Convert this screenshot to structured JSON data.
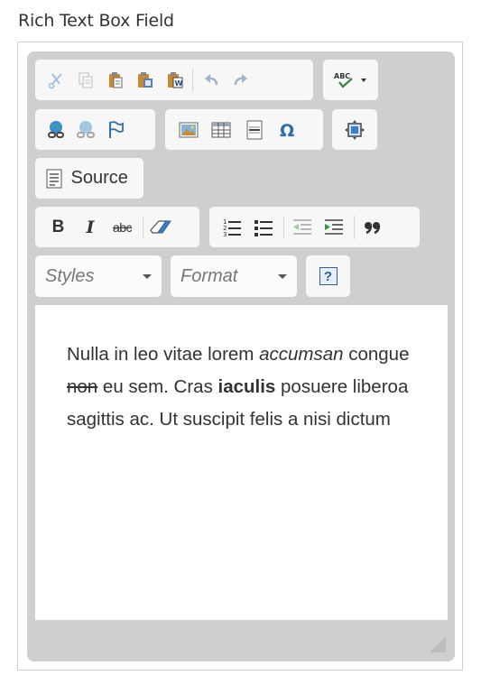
{
  "field": {
    "label": "Rich Text Box Field"
  },
  "toolbar": {
    "clipboard": [
      "cut-icon",
      "copy-icon",
      "paste-icon",
      "paste-text-icon",
      "paste-word-icon",
      "undo-icon",
      "redo-icon"
    ],
    "spellcheck_text": "ABC",
    "links": [
      "link-icon",
      "unlink-icon",
      "anchor-icon"
    ],
    "insert": [
      "image-icon",
      "table-icon",
      "horizontal-line-icon",
      "special-char-icon"
    ],
    "maximize": "maximize-icon",
    "source_label": "Source",
    "basicstyles": {
      "bold": "B",
      "italic": "I",
      "strike": "abc"
    },
    "lists": [
      "numbered-list-icon",
      "bulleted-list-icon",
      "outdent-icon",
      "indent-icon",
      "blockquote-icon"
    ],
    "styles_placeholder": "Styles",
    "format_placeholder": "Format",
    "help_label": "?"
  },
  "content": {
    "t1": "Nulla in leo vitae lorem ",
    "t2": "accumsan",
    "t3": " congue ",
    "t4": "non",
    "t5": " eu sem. Cras ",
    "t6": "iaculis",
    "t7": " posuere liberoa sagittis ac. Ut suscipit felis a nisi dictum"
  },
  "colors": {
    "editor_bg": "#cfcfcf",
    "toolbar_group": "#f7f7f7",
    "link_blue": "#2f6fb0",
    "text": "#333333"
  }
}
